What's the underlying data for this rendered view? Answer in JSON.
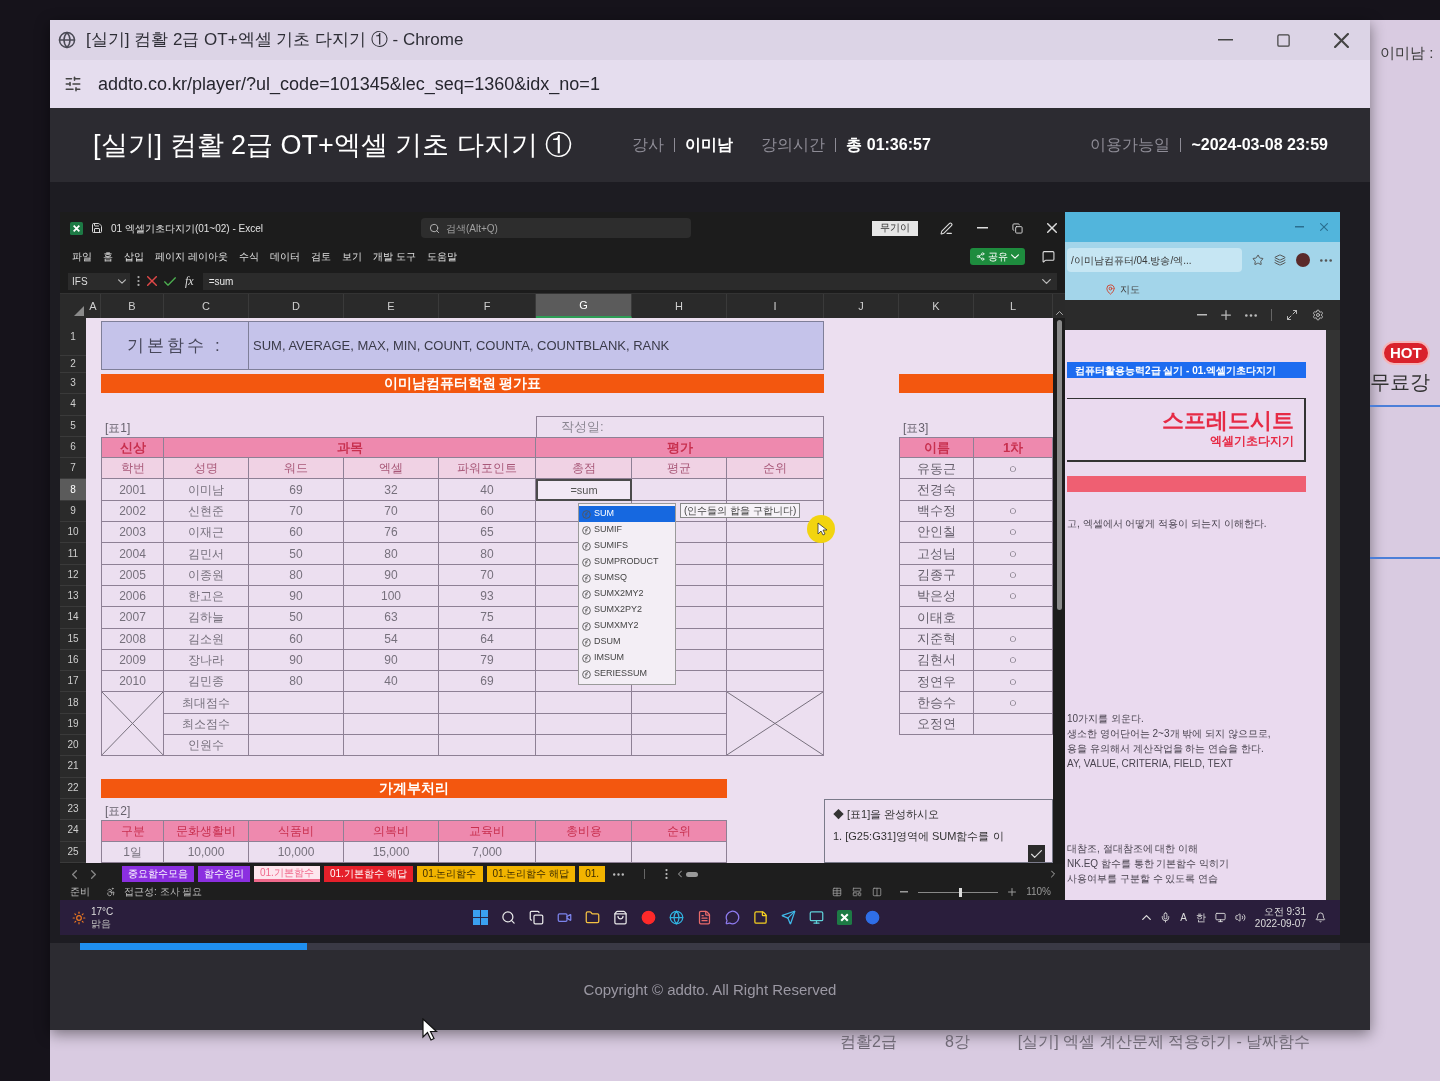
{
  "browser_window": {
    "title": "[실기] 컴활 2급 OT+엑셀 기초 다지기 ① - Chrome",
    "url": "addto.co.kr/player/?ul_code=101345&lec_seq=1360&idx_no=1"
  },
  "lecture_header": {
    "title": "[실기] 컴활 2급 OT+엑셀 기초 다지기 ①",
    "meta": [
      {
        "label": "강사",
        "value": "이미남"
      },
      {
        "label": "강의시간",
        "value": "총 01:36:57"
      },
      {
        "label": "이용가능일",
        "value": "~2024-03-08 23:59"
      }
    ]
  },
  "video_screen": {
    "excel": {
      "filename": "01 엑셀기초다지기(01~02) - Excel",
      "search_placeholder": "검색(Alt+Q)",
      "account": "무기이",
      "menu": [
        "파일",
        "홈",
        "삽입",
        "페이지 레이아웃",
        "수식",
        "데이터",
        "검토",
        "보기",
        "개발 도구",
        "도움말"
      ],
      "share_button": "공유",
      "name_box": "IFS",
      "function_button": "fx",
      "formula": "=sum",
      "columns": [
        {
          "label": "A",
          "selected": false
        },
        {
          "label": "B",
          "selected": false
        },
        {
          "label": "C",
          "selected": false
        },
        {
          "label": "D",
          "selected": false
        },
        {
          "label": "E",
          "selected": false
        },
        {
          "label": "F",
          "selected": false
        },
        {
          "label": "G",
          "selected": true
        },
        {
          "label": "H",
          "selected": false
        },
        {
          "label": "I",
          "selected": false
        },
        {
          "label": "J",
          "selected": false
        },
        {
          "label": "K",
          "selected": false
        },
        {
          "label": "L",
          "selected": false
        }
      ],
      "row_numbers": [
        {
          "label": "1",
          "selected": false
        },
        {
          "label": "2",
          "selected": false
        },
        {
          "label": "3",
          "selected": false
        },
        {
          "label": "4",
          "selected": false
        },
        {
          "label": "5",
          "selected": false
        },
        {
          "label": "6",
          "selected": false
        },
        {
          "label": "7",
          "selected": false
        },
        {
          "label": "8",
          "selected": true
        },
        {
          "label": "9",
          "selected": false
        },
        {
          "label": "10",
          "selected": false
        },
        {
          "label": "11",
          "selected": false
        },
        {
          "label": "12",
          "selected": false
        },
        {
          "label": "13",
          "selected": false
        },
        {
          "label": "14",
          "selected": false
        },
        {
          "label": "15",
          "selected": false
        },
        {
          "label": "16",
          "selected": false
        },
        {
          "label": "17",
          "selected": false
        },
        {
          "label": "18",
          "selected": false
        },
        {
          "label": "19",
          "selected": false
        },
        {
          "label": "20",
          "selected": false
        },
        {
          "label": "21",
          "selected": false
        },
        {
          "label": "22",
          "selected": false
        },
        {
          "label": "23",
          "selected": false
        },
        {
          "label": "24",
          "selected": false
        },
        {
          "label": "25",
          "selected": false
        }
      ],
      "sheet": {
        "basic_functions": {
          "label": "기본함수 :",
          "value": "SUM, AVERAGE, MAX, MIN, COUNT, COUNTA, COUNTBLANK, RANK"
        },
        "title_bar": "이미남컴퓨터학원 평가표",
        "table1": {
          "caption": "[표1]",
          "date_label": "작성일:",
          "groups": [
            "신상",
            "과목",
            "평가"
          ],
          "columns": [
            "학번",
            "성명",
            "워드",
            "엑셀",
            "파워포인트",
            "총점",
            "평균",
            "순위"
          ],
          "rows": [
            [
              "2001",
              "이미남",
              "69",
              "32",
              "40"
            ],
            [
              "2002",
              "신현준",
              "70",
              "70",
              "60"
            ],
            [
              "2003",
              "이재근",
              "60",
              "76",
              "65"
            ],
            [
              "2004",
              "김민서",
              "50",
              "80",
              "80"
            ],
            [
              "2005",
              "이종원",
              "80",
              "90",
              "70"
            ],
            [
              "2006",
              "한고은",
              "90",
              "100",
              "93"
            ],
            [
              "2007",
              "김하늘",
              "50",
              "63",
              "75"
            ],
            [
              "2008",
              "김소원",
              "60",
              "54",
              "64"
            ],
            [
              "2009",
              "장나라",
              "90",
              "90",
              "79"
            ],
            [
              "2010",
              "김민종",
              "80",
              "40",
              "69"
            ]
          ],
          "editing_cell": "=sum",
          "summary_labels": [
            "최대점수",
            "최소점수",
            "인원수"
          ]
        },
        "table3": {
          "caption": "[표3]",
          "columns": [
            "이름",
            "1차"
          ],
          "rows": [
            {
              "name": "유동근",
              "first": "○"
            },
            {
              "name": "전경숙"
            },
            {
              "name": "백수정",
              "first": "○"
            },
            {
              "name": "안인칠",
              "first": "○"
            },
            {
              "name": "고성님",
              "first": "○"
            },
            {
              "name": "김종구",
              "first": "○"
            },
            {
              "name": "박은성",
              "first": "○"
            },
            {
              "name": "이태호"
            },
            {
              "name": "지준혁",
              "first": "○"
            },
            {
              "name": "김현서",
              "first": "○"
            },
            {
              "name": "정연우",
              "first": "○"
            },
            {
              "name": "한승수",
              "first": "○"
            },
            {
              "name": "오정연"
            }
          ]
        },
        "section_title": "가계부처리",
        "table2": {
          "caption": "[표2]",
          "columns": [
            "구분",
            "문화생활비",
            "식품비",
            "의복비",
            "교육비",
            "총비용",
            "순위"
          ],
          "rows": [
            [
              "1일",
              "10,000",
              "10,000",
              "15,000",
              "7,000"
            ]
          ]
        },
        "instructions": [
          "◆ [표1]을 완성하시오",
          "1. [G25:G31]영역에 SUM함수를 이"
        ],
        "autocomplete": {
          "items": [
            {
              "label": "SUM",
              "selected": true
            },
            {
              "label": "SUMIF",
              "selected": false
            },
            {
              "label": "SUMIFS",
              "selected": false
            },
            {
              "label": "SUMPRODUCT",
              "selected": false
            },
            {
              "label": "SUMSQ",
              "selected": false
            },
            {
              "label": "SUMX2MY2",
              "selected": false
            },
            {
              "label": "SUMX2PY2",
              "selected": false
            },
            {
              "label": "SUMXMY2",
              "selected": false
            },
            {
              "label": "DSUM",
              "selected": false
            },
            {
              "label": "IMSUM",
              "selected": false
            },
            {
              "label": "SERIESSUM",
              "selected": false
            }
          ],
          "tooltip": "(인수들의 합을 구합니다)"
        }
      },
      "sheet_tabs": [
        {
          "label": "중요함수모음",
          "color": "#8b2fe0",
          "selected": false
        },
        {
          "label": "함수정리",
          "color": "#8b2fe0",
          "selected": false
        },
        {
          "label": "01.기본함수",
          "color": "#f06a8c",
          "selected": true
        },
        {
          "label": "01.기본함수 해답",
          "color": "#e5202a",
          "selected": false
        },
        {
          "label": "01.논리함수",
          "color": "#f2b400",
          "selected": false
        },
        {
          "label": "01.논리함수 해답",
          "color": "#f2b400",
          "selected": false
        },
        {
          "label": "01.",
          "color": "#f2b400",
          "selected": false
        }
      ],
      "status_bar": {
        "status": "준비",
        "accessibility": "접근성: 조사 필요",
        "zoom": "110%",
        "zoom_slider": {
          "level": 0.52
        }
      }
    },
    "pdf_viewer": {
      "address": "/이미남컴퓨터/04.방송/엑...",
      "bookmark": "지도",
      "banner": "컴퓨터활용능력2급 실기 - 01.엑셀기초다지기",
      "title": "스프레드시트",
      "subtitle": "엑셀기초다지기",
      "paragraphs": [
        [
          "고, 엑셀에서 어떻게 적용이 되는지 이해한다."
        ],
        [
          "10가지를 외운다.",
          "생소한 영어단어는 2~3개 밖에 되지 않으므로,",
          "용을 유의해서 계산작업을 하는 연습을 한다.",
          "AY, VALUE, CRITERIA, FIELD, TEXT"
        ],
        [
          "대참조, 절대참조에 대한 이해",
          "NK.EQ 함수를 통한 기본함수 익히기",
          "사용여부를 구분할 수 있도록 연습"
        ]
      ]
    },
    "taskbar": {
      "weather": {
        "temperature": "17°C",
        "condition": "맑음"
      },
      "input_mode": "A",
      "input_language": "한",
      "time": "오전 9:31",
      "date": "2022-09-07"
    }
  },
  "player": {
    "progress": {
      "level": 0.18
    }
  },
  "footer": {
    "copyright": "Copyright © addto. All Right Reserved"
  },
  "background_page": {
    "user_label": "이미남 :",
    "hot_badge": "HOT",
    "promo_title": "무료강",
    "lecture_row": {
      "course": "컴활2급",
      "lesson": "8강",
      "title": "[실기] 엑셀 계산문제 적용하기 - 날짜함수"
    }
  }
}
